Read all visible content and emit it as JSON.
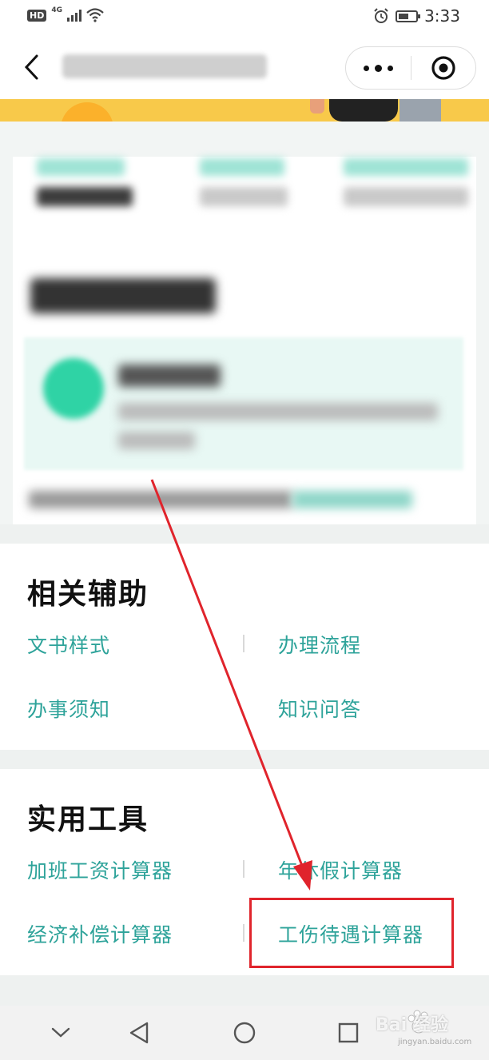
{
  "status_bar": {
    "hd": "HD",
    "network": "4G",
    "time": "3:33"
  },
  "nav": {
    "back_icon": "chevron-left-icon",
    "more_icon": "more-dots-icon",
    "close_icon": "target-circle-icon"
  },
  "sections": {
    "related": {
      "title": "相关辅助",
      "items": [
        "文书样式",
        "办理流程",
        "办事须知",
        "知识问答"
      ]
    },
    "tools": {
      "title": "实用工具",
      "items": [
        "加班工资计算器",
        "年休假计算器",
        "经济补偿计算器",
        "工伤待遇计算器"
      ]
    }
  },
  "system_nav": {
    "icons": [
      "chevron-down-icon",
      "back-triangle-icon",
      "home-circle-icon",
      "recents-square-icon"
    ]
  },
  "watermark": {
    "text": "Bai 经验",
    "sub": "jingyan.baidu.com"
  },
  "colors": {
    "accent": "#2ea39a",
    "highlight": "#e0242c",
    "banner": "#f8c94a"
  }
}
